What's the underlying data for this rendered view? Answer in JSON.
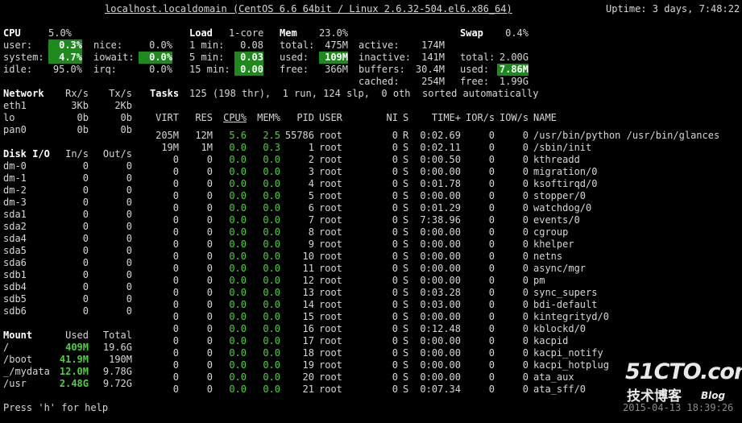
{
  "header": {
    "host": "localhost.localdomain (CentOS 6.6 64bit / Linux 2.6.32-504.el6.x86_64)",
    "uptime": "Uptime: 3 days, 7:48:22"
  },
  "cpu": {
    "title": "CPU",
    "total": "5.0%",
    "rows": [
      [
        "user:",
        "0.3%",
        "nice:",
        "0.0%"
      ],
      [
        "system:",
        "4.7%",
        "iowait:",
        "0.0%"
      ],
      [
        "idle:",
        "95.0%",
        "irq:",
        "0.0%"
      ]
    ]
  },
  "load": {
    "title": "Load",
    "cores": "1-core",
    "rows": [
      [
        "1 min:",
        "0.08"
      ],
      [
        "5 min:",
        "0.03"
      ],
      [
        "15 min:",
        "0.00"
      ]
    ]
  },
  "mem": {
    "title": "Mem",
    "total_pct": "23.0%",
    "rows": [
      [
        "total:",
        "475M",
        "active:",
        "174M"
      ],
      [
        "used:",
        "109M",
        "inactive:",
        "141M"
      ],
      [
        "free:",
        "366M",
        "buffers:",
        "30.4M"
      ]
    ],
    "cached": [
      "cached:",
      "254M"
    ]
  },
  "swap": {
    "title": "Swap",
    "total_pct": "0.4%",
    "rows": [
      [
        "total:",
        "2.00G"
      ],
      [
        "used:",
        "7.86M"
      ],
      [
        "free:",
        "1.99G"
      ]
    ]
  },
  "network": {
    "title": "Network",
    "rx": "Rx/s",
    "tx": "Tx/s",
    "rows": [
      [
        "eth1",
        "3Kb",
        "2Kb"
      ],
      [
        "lo",
        "0b",
        "0b"
      ],
      [
        "pan0",
        "0b",
        "0b"
      ]
    ]
  },
  "tasks": {
    "title": "Tasks",
    "summary": "125 (198 thr),  1 run, 124 slp,  0 oth  sorted automatically"
  },
  "proc_headers": [
    "VIRT",
    "RES",
    "CPU%",
    "MEM%",
    "PID",
    "USER",
    "NI",
    "S",
    "TIME+",
    "IOR/s",
    "IOW/s",
    "NAME"
  ],
  "processes": [
    [
      "205M",
      "12M",
      "5.6",
      "2.5",
      "55786",
      "root",
      "0",
      "R",
      "0:02.69",
      "0",
      "0",
      "/usr/bin/python /usr/bin/glances"
    ],
    [
      "19M",
      "1M",
      "0.0",
      "0.3",
      "1",
      "root",
      "0",
      "S",
      "0:02.11",
      "0",
      "0",
      "/sbin/init"
    ],
    [
      "0",
      "0",
      "0.0",
      "0.0",
      "2",
      "root",
      "0",
      "S",
      "0:00.50",
      "0",
      "0",
      "kthreadd"
    ],
    [
      "0",
      "0",
      "0.0",
      "0.0",
      "3",
      "root",
      "0",
      "S",
      "0:00.00",
      "0",
      "0",
      "migration/0"
    ],
    [
      "0",
      "0",
      "0.0",
      "0.0",
      "4",
      "root",
      "0",
      "S",
      "0:01.78",
      "0",
      "0",
      "ksoftirqd/0"
    ],
    [
      "0",
      "0",
      "0.0",
      "0.0",
      "5",
      "root",
      "0",
      "S",
      "0:00.00",
      "0",
      "0",
      "stopper/0"
    ],
    [
      "0",
      "0",
      "0.0",
      "0.0",
      "6",
      "root",
      "0",
      "S",
      "0:01.29",
      "0",
      "0",
      "watchdog/0"
    ],
    [
      "0",
      "0",
      "0.0",
      "0.0",
      "7",
      "root",
      "0",
      "S",
      "7:38.96",
      "0",
      "0",
      "events/0"
    ],
    [
      "0",
      "0",
      "0.0",
      "0.0",
      "8",
      "root",
      "0",
      "S",
      "0:00.00",
      "0",
      "0",
      "cgroup"
    ],
    [
      "0",
      "0",
      "0.0",
      "0.0",
      "9",
      "root",
      "0",
      "S",
      "0:00.00",
      "0",
      "0",
      "khelper"
    ],
    [
      "0",
      "0",
      "0.0",
      "0.0",
      "10",
      "root",
      "0",
      "S",
      "0:00.00",
      "0",
      "0",
      "netns"
    ],
    [
      "0",
      "0",
      "0.0",
      "0.0",
      "11",
      "root",
      "0",
      "S",
      "0:00.00",
      "0",
      "0",
      "async/mgr"
    ],
    [
      "0",
      "0",
      "0.0",
      "0.0",
      "12",
      "root",
      "0",
      "S",
      "0:00.00",
      "0",
      "0",
      "pm"
    ],
    [
      "0",
      "0",
      "0.0",
      "0.0",
      "13",
      "root",
      "0",
      "S",
      "0:03.28",
      "0",
      "0",
      "sync_supers"
    ],
    [
      "0",
      "0",
      "0.0",
      "0.0",
      "14",
      "root",
      "0",
      "S",
      "0:03.00",
      "0",
      "0",
      "bdi-default"
    ],
    [
      "0",
      "0",
      "0.0",
      "0.0",
      "15",
      "root",
      "0",
      "S",
      "0:00.00",
      "0",
      "0",
      "kintegrityd/0"
    ],
    [
      "0",
      "0",
      "0.0",
      "0.0",
      "16",
      "root",
      "0",
      "S",
      "0:12.48",
      "0",
      "0",
      "kblockd/0"
    ],
    [
      "0",
      "0",
      "0.0",
      "0.0",
      "17",
      "root",
      "0",
      "S",
      "0:00.00",
      "0",
      "0",
      "kacpid"
    ],
    [
      "0",
      "0",
      "0.0",
      "0.0",
      "18",
      "root",
      "0",
      "S",
      "0:00.00",
      "0",
      "0",
      "kacpi_notify"
    ],
    [
      "0",
      "0",
      "0.0",
      "0.0",
      "19",
      "root",
      "0",
      "S",
      "0:00.00",
      "0",
      "0",
      "kacpi_hotplug"
    ],
    [
      "0",
      "0",
      "0.0",
      "0.0",
      "20",
      "root",
      "0",
      "S",
      "0:00.00",
      "0",
      "0",
      "ata_aux"
    ],
    [
      "0",
      "0",
      "0.0",
      "0.0",
      "21",
      "root",
      "0",
      "S",
      "0:07.34",
      "0",
      "0",
      "ata_sff/0"
    ]
  ],
  "disk": {
    "title": "Disk I/O",
    "in": "In/s",
    "out": "Out/s",
    "rows": [
      [
        "dm-0",
        "0",
        "0"
      ],
      [
        "dm-1",
        "0",
        "0"
      ],
      [
        "dm-2",
        "0",
        "0"
      ],
      [
        "dm-3",
        "0",
        "0"
      ],
      [
        "sda1",
        "0",
        "0"
      ],
      [
        "sda2",
        "0",
        "0"
      ],
      [
        "sda4",
        "0",
        "0"
      ],
      [
        "sda5",
        "0",
        "0"
      ],
      [
        "sda6",
        "0",
        "0"
      ],
      [
        "sdb1",
        "0",
        "0"
      ],
      [
        "sdb4",
        "0",
        "0"
      ],
      [
        "sdb5",
        "0",
        "0"
      ],
      [
        "sdb6",
        "0",
        "0"
      ]
    ]
  },
  "mount": {
    "title": "Mount",
    "used": "Used",
    "total": "Total",
    "rows": [
      [
        "/",
        "409M",
        "19.6G"
      ],
      [
        "/boot",
        "41.9M",
        "190M"
      ],
      [
        "_/mydata",
        "12.0M",
        "9.78G"
      ],
      [
        "/usr",
        "2.48G",
        "9.72G"
      ]
    ]
  },
  "footer": {
    "help": "Press 'h' for help",
    "datetime": "2015-04-13 18:39:26"
  },
  "watermark": {
    "logo": "51CTO.com",
    "sub": "技术博客",
    "blog": "Blog"
  },
  "colors": {
    "background": "#000000",
    "text": "#d6d6d6",
    "ok": "#4bd13a",
    "highlight": "#1e8a1e"
  }
}
